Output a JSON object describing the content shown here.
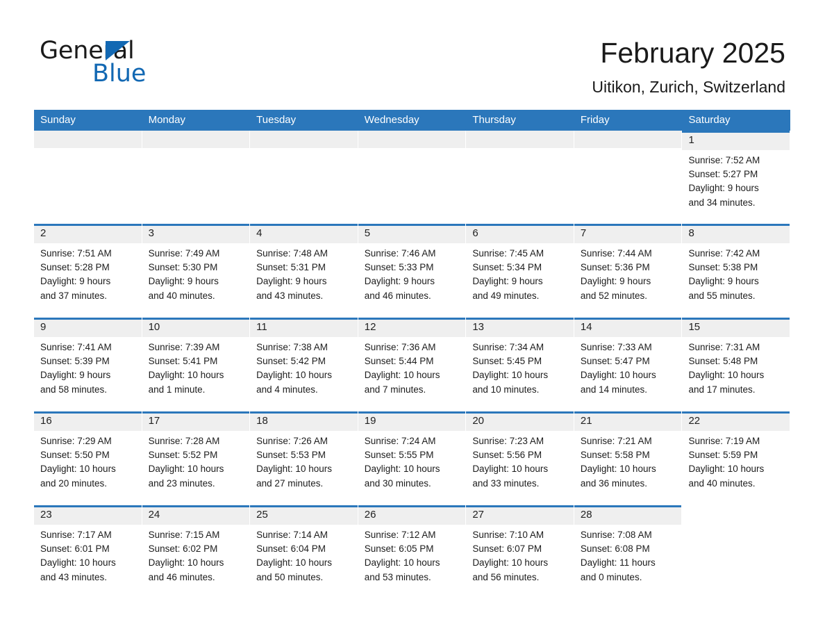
{
  "brand": {
    "word_one": "General",
    "word_two": "Blue",
    "triangle_color": "#1268b3",
    "icon": "triangle-logo-icon"
  },
  "header": {
    "month_title": "February 2025",
    "location": "Uitikon, Zurich, Switzerland"
  },
  "theme": {
    "header_blue": "#2b77bb",
    "strip_grey": "#efefef",
    "text_dark": "#1a1a1a",
    "brand_blue": "#1268b3",
    "page_background": "#ffffff"
  },
  "weekday_headers": [
    "Sunday",
    "Monday",
    "Tuesday",
    "Wednesday",
    "Thursday",
    "Friday",
    "Saturday"
  ],
  "weeks": [
    [
      {
        "day": "",
        "lines": []
      },
      {
        "day": "",
        "lines": []
      },
      {
        "day": "",
        "lines": []
      },
      {
        "day": "",
        "lines": []
      },
      {
        "day": "",
        "lines": []
      },
      {
        "day": "",
        "lines": []
      },
      {
        "day": "1",
        "lines": [
          "Sunrise: 7:52 AM",
          "Sunset: 5:27 PM",
          "Daylight: 9 hours",
          "and 34 minutes."
        ]
      }
    ],
    [
      {
        "day": "2",
        "lines": [
          "Sunrise: 7:51 AM",
          "Sunset: 5:28 PM",
          "Daylight: 9 hours",
          "and 37 minutes."
        ]
      },
      {
        "day": "3",
        "lines": [
          "Sunrise: 7:49 AM",
          "Sunset: 5:30 PM",
          "Daylight: 9 hours",
          "and 40 minutes."
        ]
      },
      {
        "day": "4",
        "lines": [
          "Sunrise: 7:48 AM",
          "Sunset: 5:31 PM",
          "Daylight: 9 hours",
          "and 43 minutes."
        ]
      },
      {
        "day": "5",
        "lines": [
          "Sunrise: 7:46 AM",
          "Sunset: 5:33 PM",
          "Daylight: 9 hours",
          "and 46 minutes."
        ]
      },
      {
        "day": "6",
        "lines": [
          "Sunrise: 7:45 AM",
          "Sunset: 5:34 PM",
          "Daylight: 9 hours",
          "and 49 minutes."
        ]
      },
      {
        "day": "7",
        "lines": [
          "Sunrise: 7:44 AM",
          "Sunset: 5:36 PM",
          "Daylight: 9 hours",
          "and 52 minutes."
        ]
      },
      {
        "day": "8",
        "lines": [
          "Sunrise: 7:42 AM",
          "Sunset: 5:38 PM",
          "Daylight: 9 hours",
          "and 55 minutes."
        ]
      }
    ],
    [
      {
        "day": "9",
        "lines": [
          "Sunrise: 7:41 AM",
          "Sunset: 5:39 PM",
          "Daylight: 9 hours",
          "and 58 minutes."
        ]
      },
      {
        "day": "10",
        "lines": [
          "Sunrise: 7:39 AM",
          "Sunset: 5:41 PM",
          "Daylight: 10 hours",
          "and 1 minute."
        ]
      },
      {
        "day": "11",
        "lines": [
          "Sunrise: 7:38 AM",
          "Sunset: 5:42 PM",
          "Daylight: 10 hours",
          "and 4 minutes."
        ]
      },
      {
        "day": "12",
        "lines": [
          "Sunrise: 7:36 AM",
          "Sunset: 5:44 PM",
          "Daylight: 10 hours",
          "and 7 minutes."
        ]
      },
      {
        "day": "13",
        "lines": [
          "Sunrise: 7:34 AM",
          "Sunset: 5:45 PM",
          "Daylight: 10 hours",
          "and 10 minutes."
        ]
      },
      {
        "day": "14",
        "lines": [
          "Sunrise: 7:33 AM",
          "Sunset: 5:47 PM",
          "Daylight: 10 hours",
          "and 14 minutes."
        ]
      },
      {
        "day": "15",
        "lines": [
          "Sunrise: 7:31 AM",
          "Sunset: 5:48 PM",
          "Daylight: 10 hours",
          "and 17 minutes."
        ]
      }
    ],
    [
      {
        "day": "16",
        "lines": [
          "Sunrise: 7:29 AM",
          "Sunset: 5:50 PM",
          "Daylight: 10 hours",
          "and 20 minutes."
        ]
      },
      {
        "day": "17",
        "lines": [
          "Sunrise: 7:28 AM",
          "Sunset: 5:52 PM",
          "Daylight: 10 hours",
          "and 23 minutes."
        ]
      },
      {
        "day": "18",
        "lines": [
          "Sunrise: 7:26 AM",
          "Sunset: 5:53 PM",
          "Daylight: 10 hours",
          "and 27 minutes."
        ]
      },
      {
        "day": "19",
        "lines": [
          "Sunrise: 7:24 AM",
          "Sunset: 5:55 PM",
          "Daylight: 10 hours",
          "and 30 minutes."
        ]
      },
      {
        "day": "20",
        "lines": [
          "Sunrise: 7:23 AM",
          "Sunset: 5:56 PM",
          "Daylight: 10 hours",
          "and 33 minutes."
        ]
      },
      {
        "day": "21",
        "lines": [
          "Sunrise: 7:21 AM",
          "Sunset: 5:58 PM",
          "Daylight: 10 hours",
          "and 36 minutes."
        ]
      },
      {
        "day": "22",
        "lines": [
          "Sunrise: 7:19 AM",
          "Sunset: 5:59 PM",
          "Daylight: 10 hours",
          "and 40 minutes."
        ]
      }
    ],
    [
      {
        "day": "23",
        "lines": [
          "Sunrise: 7:17 AM",
          "Sunset: 6:01 PM",
          "Daylight: 10 hours",
          "and 43 minutes."
        ]
      },
      {
        "day": "24",
        "lines": [
          "Sunrise: 7:15 AM",
          "Sunset: 6:02 PM",
          "Daylight: 10 hours",
          "and 46 minutes."
        ]
      },
      {
        "day": "25",
        "lines": [
          "Sunrise: 7:14 AM",
          "Sunset: 6:04 PM",
          "Daylight: 10 hours",
          "and 50 minutes."
        ]
      },
      {
        "day": "26",
        "lines": [
          "Sunrise: 7:12 AM",
          "Sunset: 6:05 PM",
          "Daylight: 10 hours",
          "and 53 minutes."
        ]
      },
      {
        "day": "27",
        "lines": [
          "Sunrise: 7:10 AM",
          "Sunset: 6:07 PM",
          "Daylight: 10 hours",
          "and 56 minutes."
        ]
      },
      {
        "day": "28",
        "lines": [
          "Sunrise: 7:08 AM",
          "Sunset: 6:08 PM",
          "Daylight: 11 hours",
          "and 0 minutes."
        ]
      },
      {
        "day": "",
        "lines": []
      }
    ]
  ]
}
